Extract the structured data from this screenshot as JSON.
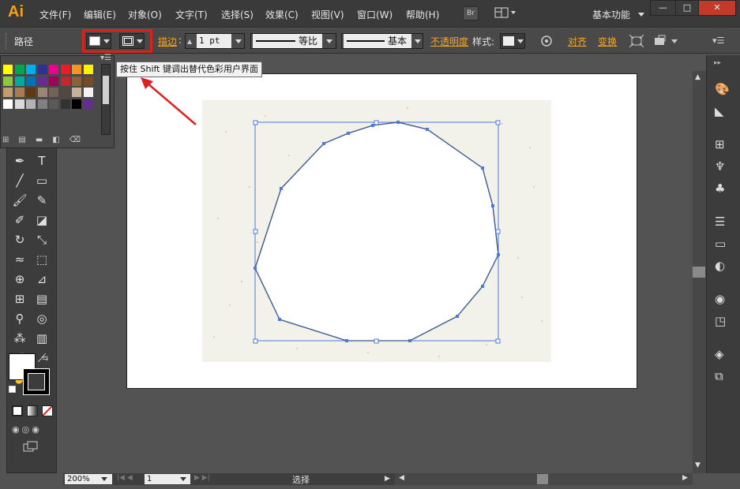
{
  "app": {
    "logo": "Ai",
    "bridge_label": "Br",
    "workspace": "基本功能",
    "window_minimize": "—",
    "window_maximize": "□",
    "window_close": "✕"
  },
  "menu": [
    "文件(F)",
    "编辑(E)",
    "对象(O)",
    "文字(T)",
    "选择(S)",
    "效果(C)",
    "视图(V)",
    "窗口(W)",
    "帮助(H)"
  ],
  "control_bar": {
    "selection_label": "路径",
    "stroke_link": "描边",
    "stroke_weight": "1 pt",
    "stroke_profile": "等比",
    "brush": "基本",
    "opacity_link": "不透明度",
    "style_label": "样式:",
    "align_link": "对齐",
    "transform_link": "变换"
  },
  "tooltip": "按住 Shift 键调出替代色彩用户界面",
  "status": {
    "zoom": "200%",
    "artboard": "1",
    "tool_status": "选择"
  },
  "colors": {
    "accent": "#f5a623",
    "highlight": "#d9241c",
    "selection": "#4a7bd8"
  },
  "swatches": [
    "#ffff00",
    "#00a651",
    "#00aeef",
    "#2e3192",
    "#ec008c",
    "#ed1c24",
    "#f7941d",
    "#fff200",
    "#8dc63f",
    "#00a99d",
    "#0072bc",
    "#662d91",
    "#9e005d",
    "#c1272d",
    "#8c6239",
    "#754c24",
    "#c69c6d",
    "#a67c52",
    "#603913",
    "#998675",
    "#736357",
    "#534741",
    "#c7b299",
    "#f2f2f2",
    "#ffffff",
    "#d9d9d9",
    "#b3b3b3",
    "#808080",
    "#595959",
    "#333333",
    "#000000",
    "#662d91"
  ],
  "icons": {
    "toolbar": [
      "selection-tool-icon",
      "direct-selection-tool-icon",
      "magic-wand-icon",
      "lasso-icon",
      "pen-tool-icon",
      "type-tool-icon",
      "line-tool-icon",
      "rectangle-tool-icon",
      "paintbrush-icon",
      "pencil-icon",
      "blob-brush-icon",
      "eraser-icon",
      "rotate-icon",
      "scale-icon",
      "warp-icon",
      "free-transform-icon",
      "shape-builder-icon",
      "perspective-grid-icon",
      "mesh-icon",
      "gradient-icon",
      "eyedropper-icon",
      "blend-icon",
      "symbol-sprayer-icon",
      "column-graph-icon",
      "artboard-tool-icon",
      "slice-icon",
      "hand-icon",
      "zoom-icon"
    ],
    "right_panel": [
      "color-panel-icon",
      "color-guide-icon",
      "swatches-panel-icon",
      "brushes-icon",
      "symbols-icon",
      "stroke-icon",
      "gradient-panel-icon",
      "transparency-icon",
      "appearance-icon",
      "graphic-styles-icon",
      "layers-icon",
      "artboards-panel-icon"
    ]
  }
}
